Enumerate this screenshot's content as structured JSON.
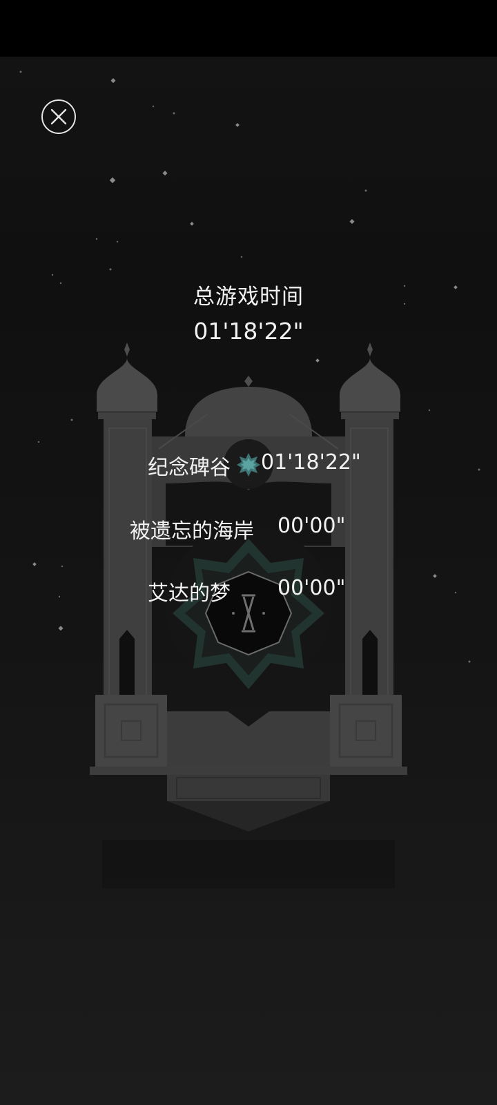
{
  "summary": {
    "title": "总游戏时间",
    "time": "01'18'22\""
  },
  "chapters": [
    {
      "name": "纪念碑谷",
      "time": "01'18'22\"",
      "completed": true
    },
    {
      "name": "被遗忘的海岸",
      "time": "00'00\"",
      "completed": false
    },
    {
      "name": "艾达的梦",
      "time": "00'00\"",
      "completed": false
    }
  ],
  "icons": {
    "close": "close-icon",
    "completed": "star-icon",
    "gate_emblem": "roman-numeral-ten-emblem"
  },
  "colors": {
    "background": "#141414",
    "text": "#f2f2f2",
    "monument": "#474747",
    "emblem_accent": "#2c4a44"
  }
}
